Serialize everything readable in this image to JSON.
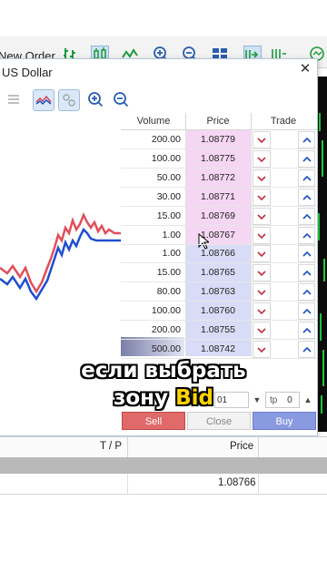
{
  "toolbar": {
    "new_order_label": "New Order",
    "icons": [
      "bar-chart-icon",
      "candlestick-icon",
      "line-chart-icon",
      "zoom-in-icon",
      "zoom-out-icon",
      "tile-windows-icon",
      "autoscroll-icon",
      "chart-shift-icon",
      "indicators-icon"
    ]
  },
  "window": {
    "title": "US Dollar",
    "tools": [
      "list-icon",
      "depth-icon",
      "ticks-icon",
      "zoom-in-icon",
      "zoom-out-icon"
    ]
  },
  "dom": {
    "headers": {
      "volume": "Volume",
      "price": "Price",
      "trade": "Trade"
    },
    "ask_rows": [
      {
        "volume": "200.00",
        "price": "1.08779"
      },
      {
        "volume": "100.00",
        "price": "1.08775"
      },
      {
        "volume": "50.00",
        "price": "1.08772"
      },
      {
        "volume": "30.00",
        "price": "1.08771"
      },
      {
        "volume": "15.00",
        "price": "1.08769"
      },
      {
        "volume": "1.00",
        "price": "1.08767"
      }
    ],
    "bid_rows": [
      {
        "volume": "1.00",
        "price": "1.08766"
      },
      {
        "volume": "15.00",
        "price": "1.08765"
      },
      {
        "volume": "80.00",
        "price": "1.08763"
      },
      {
        "volume": "100.00",
        "price": "1.08760"
      },
      {
        "volume": "200.00",
        "price": "1.08755"
      },
      {
        "volume": "500.00",
        "price": "1.08742"
      }
    ],
    "volume_field": "01",
    "tp_label": "tp",
    "tp_value": "0",
    "sell_label": "Sell",
    "close_label": "Close",
    "buy_label": "Buy"
  },
  "bottom_table": {
    "headers": {
      "tp": "T / P",
      "price": "Price"
    },
    "row_price": "1.08766"
  },
  "caption": {
    "line1": "если выбрать",
    "line2_prefix": "зону ",
    "line2_highlight": "Bid"
  },
  "colors": {
    "ask_price_bg": "#f5d6f3",
    "bid_price_bg": "#d9dcf6",
    "sell_button": "#e06a6a",
    "buy_button": "#8a9ae0",
    "caption_highlight": "#ffd400",
    "ask_line": "#e0505a",
    "bid_line": "#1f4fcf"
  }
}
